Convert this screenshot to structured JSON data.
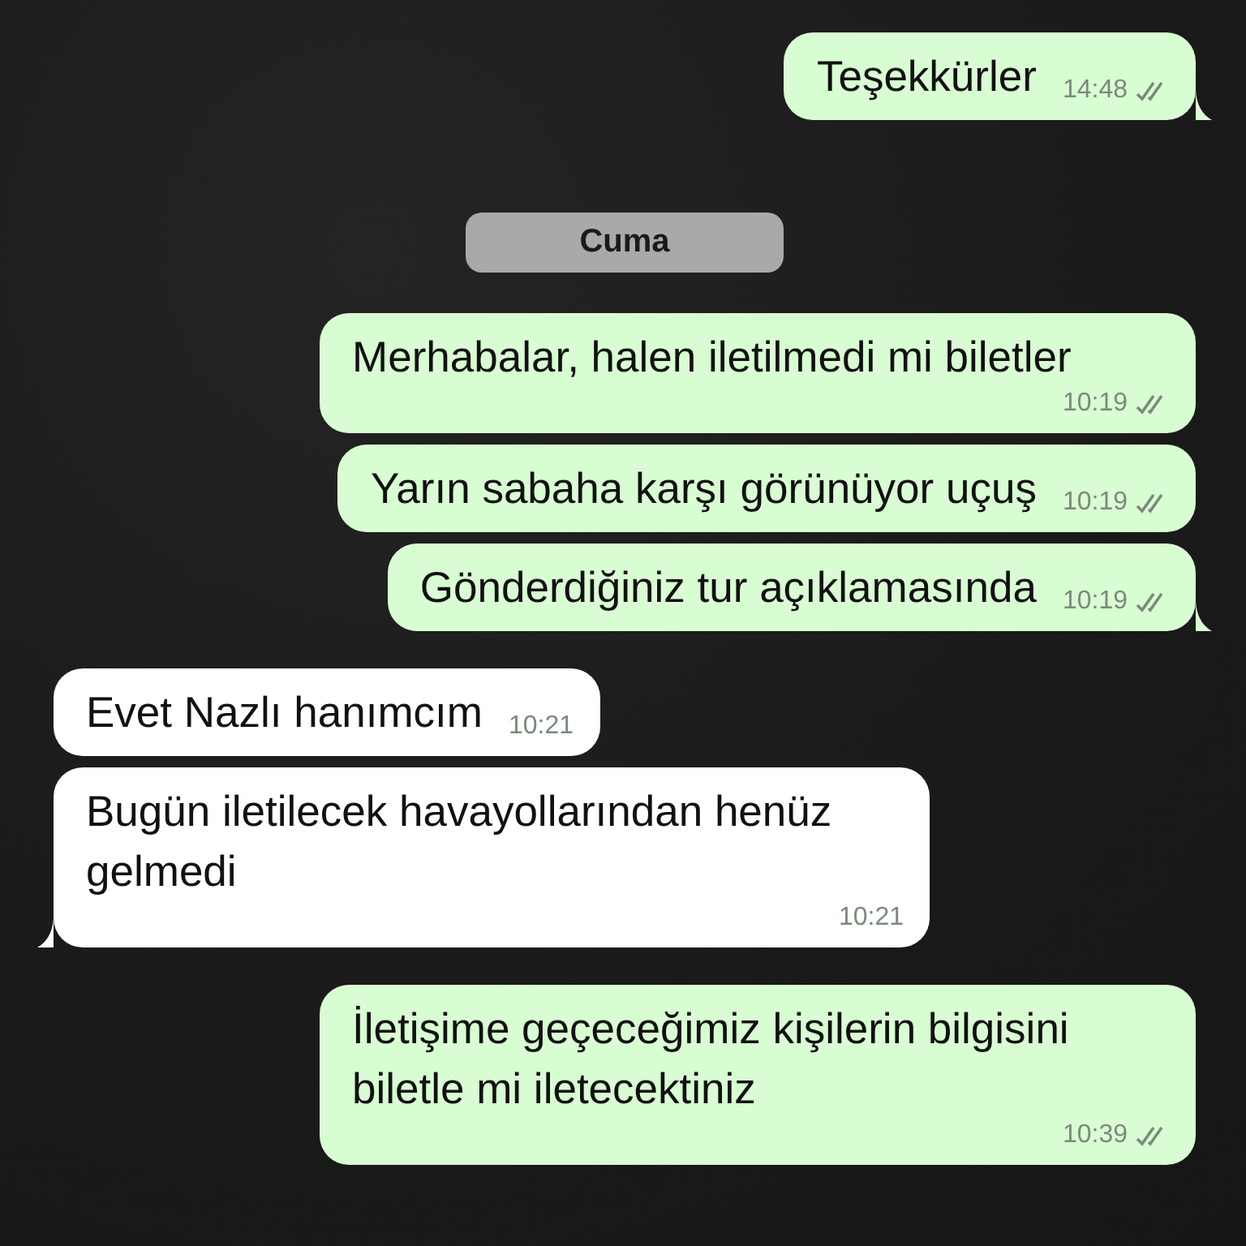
{
  "messages": [
    {
      "kind": "message",
      "outgoing": true,
      "text": "Teşekkürler",
      "time": "14:48",
      "tail": true
    },
    {
      "kind": "date",
      "text": "Cuma"
    },
    {
      "kind": "message",
      "outgoing": true,
      "text": "Merhabalar, halen iletilmedi mi biletler",
      "time": "10:19",
      "tail": false
    },
    {
      "kind": "message",
      "outgoing": true,
      "text": "Yarın sabaha karşı görünüyor uçuş",
      "time": "10:19",
      "tail": false
    },
    {
      "kind": "message",
      "outgoing": true,
      "text": "Gönderdiğiniz tur açıklamasında",
      "time": "10:19",
      "tail": true
    },
    {
      "kind": "message",
      "outgoing": false,
      "text": "Evet Nazlı hanımcım",
      "time": "10:21",
      "tail": false
    },
    {
      "kind": "message",
      "outgoing": false,
      "text": "Bugün iletilecek havayollarından henüz gelmedi",
      "time": "10:21",
      "tail": true
    },
    {
      "kind": "message",
      "outgoing": true,
      "text": "İletişime geçeceğimiz kişilerin bilgisini biletle mi iletecektiniz",
      "time": "10:39",
      "tail": false
    }
  ]
}
